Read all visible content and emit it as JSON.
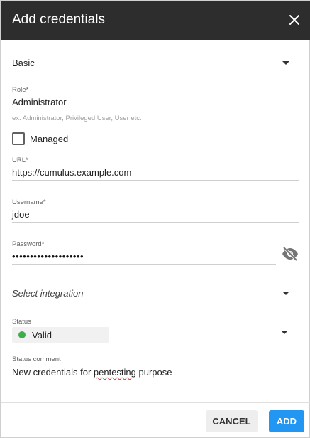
{
  "dialog": {
    "title": "Add credentials"
  },
  "type_select": {
    "value": "Basic"
  },
  "role": {
    "label": "Role",
    "required_mark": "*",
    "value": "Administrator",
    "hint": "ex. Administrator, Privileged User, User etc."
  },
  "managed": {
    "label": "Managed",
    "checked": false
  },
  "url": {
    "label": "URL",
    "required_mark": "*",
    "value": "https://cumulus.example.com"
  },
  "username": {
    "label": "Username",
    "required_mark": "*",
    "value": "jdoe"
  },
  "password": {
    "label": "Password",
    "required_mark": "*",
    "masked_value": "••••••••••••••••••••",
    "visibility_icon": "eye-off-icon"
  },
  "integration": {
    "placeholder": "Select integration"
  },
  "status": {
    "label": "Status",
    "value": "Valid",
    "dot_color": "#3fae49"
  },
  "status_comment": {
    "label": "Status comment",
    "value_before": "New credentials for ",
    "value_misspelled": "pentesting",
    "value_after": " purpose"
  },
  "footer": {
    "cancel_label": "CANCEL",
    "add_label": "ADD"
  },
  "colors": {
    "header_bg": "#2d2d2d",
    "primary": "#2196f3",
    "status_valid": "#3fae49"
  }
}
